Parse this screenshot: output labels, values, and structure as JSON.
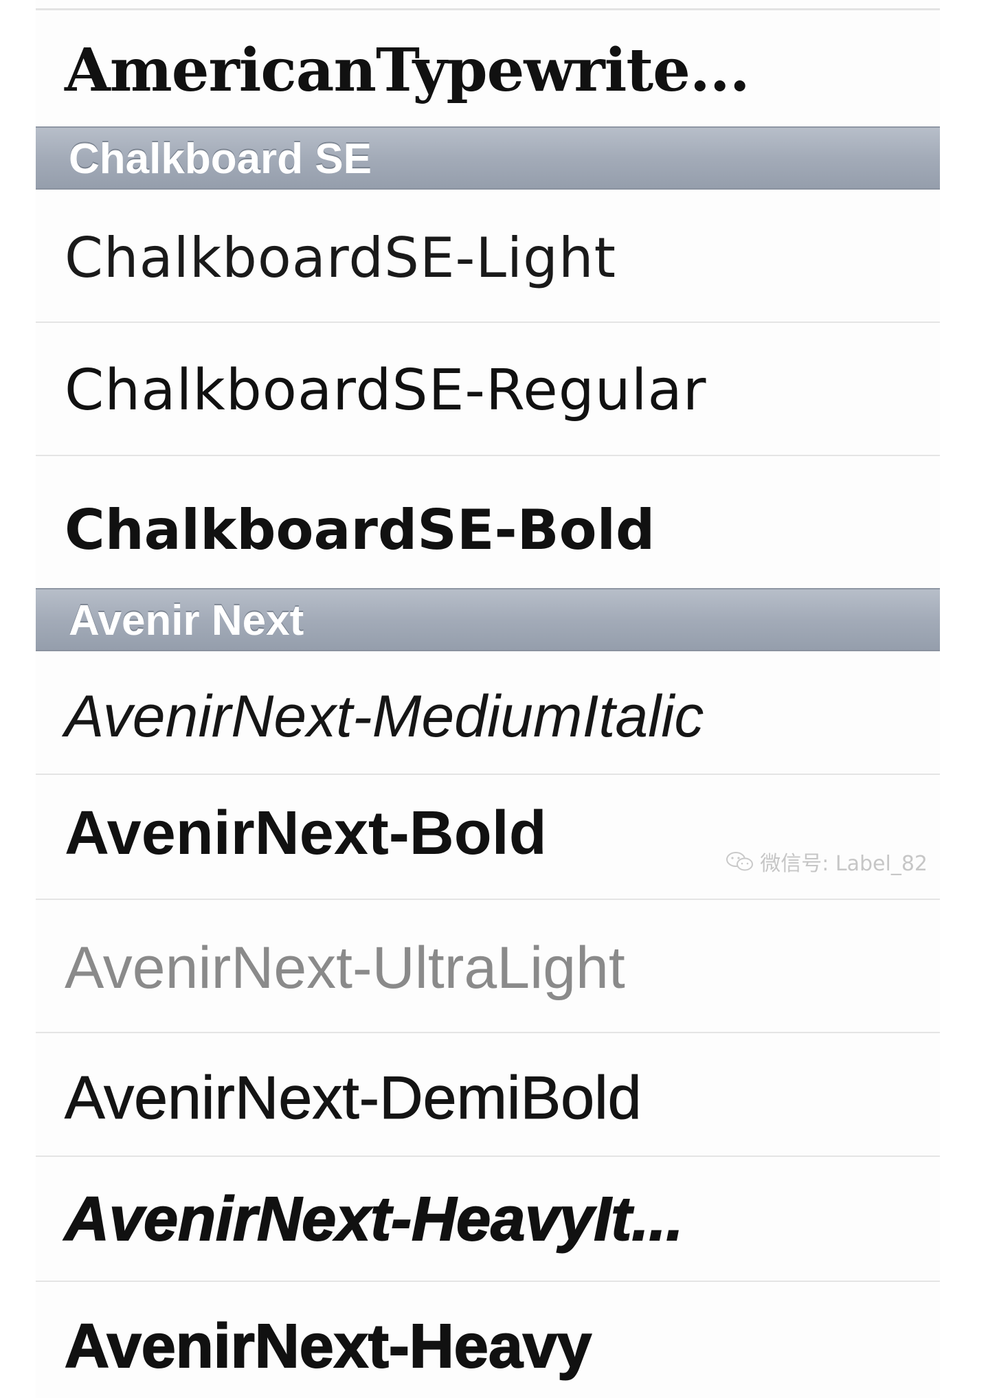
{
  "font_list": {
    "rows_before_sections": [
      {
        "label": "AmericanTypewrite..."
      }
    ],
    "sections": [
      {
        "header": "Chalkboard SE",
        "rows": [
          {
            "label": "ChalkboardSE-Light"
          },
          {
            "label": "ChalkboardSE-Regular"
          },
          {
            "label": "ChalkboardSE-Bold"
          }
        ]
      },
      {
        "header": "Avenir Next",
        "rows": [
          {
            "label": "AvenirNext-MediumItalic"
          },
          {
            "label": "AvenirNext-Bold"
          },
          {
            "label": "AvenirNext-UltraLight"
          },
          {
            "label": "AvenirNext-DemiBold"
          },
          {
            "label": "AvenirNext-HeavyIt..."
          },
          {
            "label": "AvenirNext-Heavy"
          }
        ]
      }
    ]
  },
  "watermark": {
    "text": "微信号: Label_82",
    "icon": "wechat-icon"
  },
  "colors": {
    "section_header_bg": "#a3abb8",
    "section_header_text": "#ffffff",
    "row_bg": "#fdfdfd",
    "separator": "#e4e4e4",
    "ultralight_text": "#8a8a8a"
  }
}
